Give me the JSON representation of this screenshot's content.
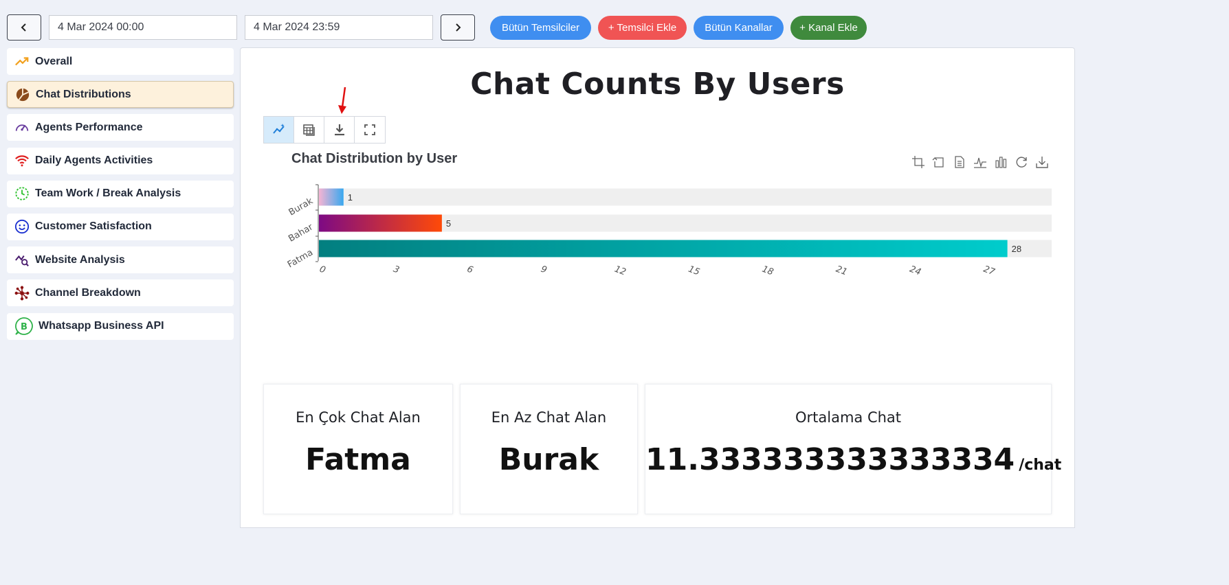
{
  "header": {
    "start_date": "4 Mar 2024 00:00",
    "end_date": "4 Mar 2024 23:59",
    "buttons": [
      {
        "label": "Bütün Temsilciler",
        "color": "#3f8ef0"
      },
      {
        "label": "+ Temsilci Ekle",
        "color": "#f05454"
      },
      {
        "label": "Bütün Kanallar",
        "color": "#3f8ef0"
      },
      {
        "label": "+ Kanal Ekle",
        "color": "#3f8a3d"
      }
    ]
  },
  "sidebar": {
    "items": [
      {
        "label": "Overall",
        "icon": "trend-up-icon"
      },
      {
        "label": "Chat Distributions",
        "icon": "pie-chart-icon",
        "active": true
      },
      {
        "label": "Agents Performance",
        "icon": "gauge-icon"
      },
      {
        "label": "Daily Agents Activities",
        "icon": "wifi-icon"
      },
      {
        "label": "Team Work / Break Analysis",
        "icon": "clock-icon"
      },
      {
        "label": "Customer Satisfaction",
        "icon": "smiley-icon"
      },
      {
        "label": "Website Analysis",
        "icon": "analytics-search-icon"
      },
      {
        "label": "Channel Breakdown",
        "icon": "network-icon"
      },
      {
        "label": "Whatsapp Business API",
        "icon": "whatsapp-business-icon"
      }
    ]
  },
  "main": {
    "title": "Chat Counts By Users",
    "chart_title": "Chat Distribution by User"
  },
  "chart_data": {
    "type": "bar",
    "orientation": "horizontal",
    "title": "Chat Distribution by User",
    "categories": [
      "Burak",
      "Bahar",
      "Fatma"
    ],
    "values": [
      1,
      5,
      28
    ],
    "xlim": [
      0,
      29.8
    ],
    "xticks": [
      0,
      3,
      6,
      9,
      12,
      15,
      18,
      21,
      24,
      27
    ],
    "grid": false,
    "background_bars": true,
    "data_labels": true
  },
  "stats": [
    {
      "label": "En Çok Chat Alan",
      "value": "Fatma",
      "unit": ""
    },
    {
      "label": "En Az Chat Alan",
      "value": "Burak",
      "unit": ""
    },
    {
      "label": "Ortalama Chat",
      "value": "11.333333333333334",
      "unit": "/chat"
    }
  ]
}
